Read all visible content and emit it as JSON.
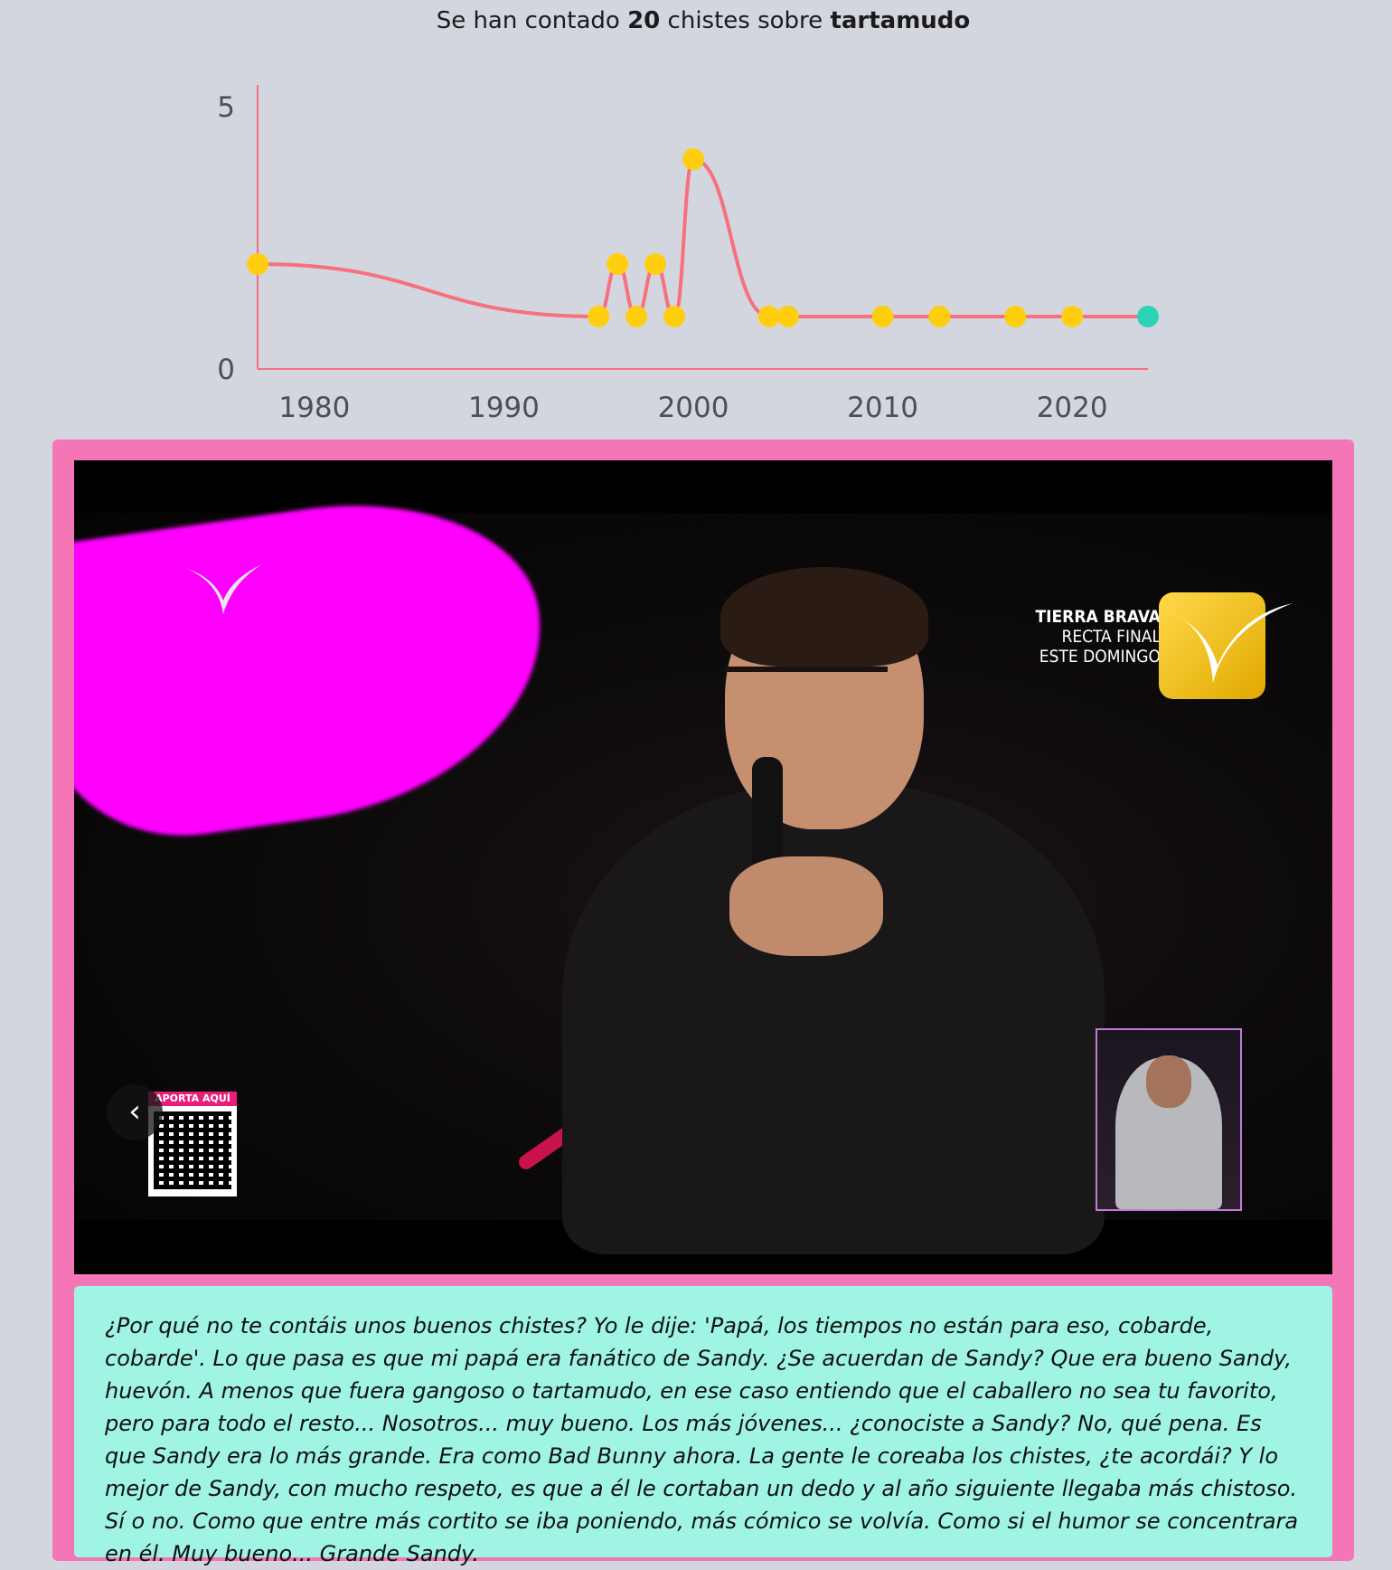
{
  "headline": {
    "prefix": "Se han contado ",
    "count": "20",
    "middle": " chistes sobre ",
    "topic": "tartamudo"
  },
  "chart_data": {
    "type": "line",
    "x": [
      1977,
      1995,
      1996,
      1997,
      1998,
      1999,
      2000,
      2004,
      2005,
      2010,
      2013,
      2017,
      2020,
      2024
    ],
    "values": [
      2,
      1,
      2,
      1,
      2,
      1,
      4,
      1,
      1,
      1,
      1,
      1,
      1,
      1
    ],
    "xlim": [
      1977,
      2024
    ],
    "ylim": [
      0,
      5
    ],
    "x_ticks": [
      "1980",
      "1990",
      "2000",
      "2010",
      "2020"
    ],
    "y_ticks": [
      "0",
      "5"
    ],
    "line_color": "#f6707f",
    "point_color": "#ffcf0f",
    "last_point_color": "#2ed3b7",
    "grid": false
  },
  "video": {
    "logo_line1": "TIERRA BRAVA",
    "logo_line2": "RECTA FINAL",
    "logo_line3": "ESTE DOMINGO",
    "qr_label": "APORTA AQUÍ",
    "prev_icon": "chevron-left-icon"
  },
  "caption": {
    "text": "¿Por qué no te contáis unos buenos chistes? Yo le dije: 'Papá, los tiempos no están para eso, cobarde, cobarde'. Lo que pasa es que mi papá era fanático de Sandy. ¿Se acuerdan de Sandy? Que era bueno Sandy, huevón. A menos que fuera gangoso o tartamudo, en ese caso entiendo que el caballero no sea tu favorito, pero para todo el resto... Nosotros... muy bueno. Los más jóvenes... ¿conociste a Sandy? No, qué pena. Es que Sandy era lo más grande. Era como Bad Bunny ahora. La gente le coreaba los chistes, ¿te acordái? Y lo mejor de Sandy, con mucho respeto, es que a él le cortaban un dedo y al año siguiente llegaba más chistoso. Sí o no. Como que entre más cortito se iba poniendo, más cómico se volvía. Como si el humor se concentrara en él. Muy bueno... Grande Sandy."
  },
  "colors": {
    "page_bg": "#d3d6de",
    "card_bg": "#f476b6",
    "caption_bg": "#9ff4e4"
  }
}
